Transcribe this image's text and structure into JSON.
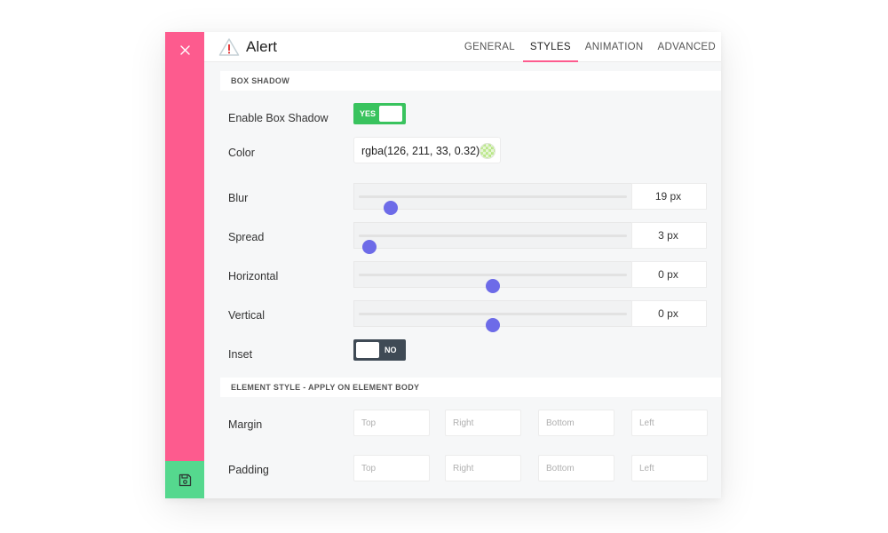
{
  "header": {
    "title": "Alert",
    "tabs": [
      {
        "label": "GENERAL",
        "active": false
      },
      {
        "label": "STYLES",
        "active": true
      },
      {
        "label": "ANIMATION",
        "active": false
      },
      {
        "label": "ADVANCED",
        "active": false
      }
    ]
  },
  "sidebar": {
    "close_icon": "close-icon",
    "save_icon": "save-icon",
    "colors": {
      "sidebar": "#fd5b8e",
      "save": "#55d88e"
    }
  },
  "box_shadow": {
    "section_title": "BOX SHADOW",
    "enable": {
      "label": "Enable Box Shadow",
      "toggle_text": "YES",
      "on": true
    },
    "color": {
      "label": "Color",
      "value": "rgba(126, 211, 33, 0.32)"
    },
    "sliders": [
      {
        "label": "Blur",
        "value_text": "19 px",
        "position_fraction": 0.12
      },
      {
        "label": "Spread",
        "value_text": "3 px",
        "position_fraction": 0.04
      },
      {
        "label": "Horizontal",
        "value_text": "0 px",
        "position_fraction": 0.5
      },
      {
        "label": "Vertical",
        "value_text": "0 px",
        "position_fraction": 0.5
      }
    ],
    "inset": {
      "label": "Inset",
      "toggle_text": "NO",
      "on": false
    }
  },
  "element_style": {
    "section_title": "ELEMENT STYLE - APPLY ON ELEMENT BODY",
    "margin": {
      "label": "Margin",
      "placeholders": [
        "Top",
        "Right",
        "Bottom",
        "Left"
      ]
    },
    "padding": {
      "label": "Padding",
      "placeholders": [
        "Top",
        "Right",
        "Bottom",
        "Left"
      ]
    }
  },
  "colors": {
    "accent": "#fd5b8e",
    "slider_thumb": "#6d6be8",
    "toggle_on": "#39c35e",
    "toggle_off": "#3f4a55"
  }
}
